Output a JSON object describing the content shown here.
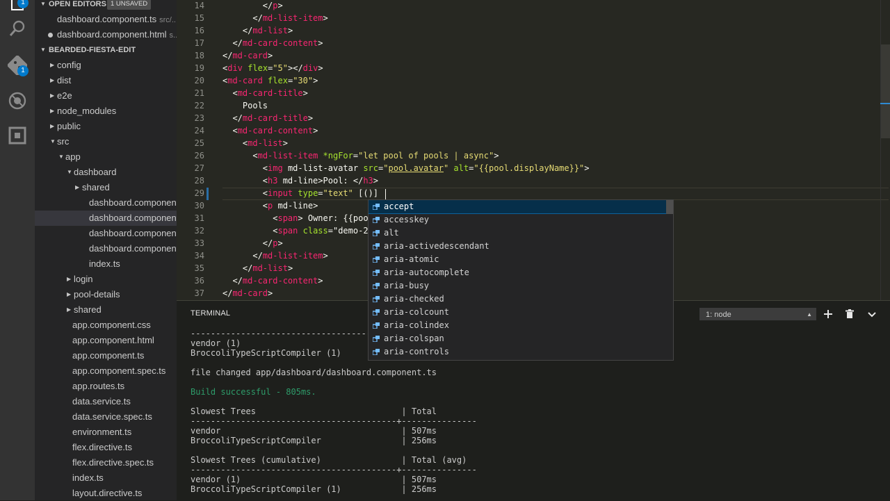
{
  "activity_bar": {
    "icons": [
      "explorer-icon",
      "search-icon",
      "source-control-icon",
      "debug-icon",
      "extensions-icon"
    ],
    "explorer_badge": "1",
    "scm_badge": "1"
  },
  "sidebar": {
    "open_editors": {
      "title": "OPEN EDITORS",
      "badge": "1 UNSAVED",
      "items": [
        {
          "name": "dashboard.component.ts",
          "desc": "src/...",
          "dirty": false
        },
        {
          "name": "dashboard.component.html",
          "desc": "s...",
          "dirty": true
        }
      ]
    },
    "project": {
      "title": "BEARDED-FIESTA-EDIT",
      "tree": [
        {
          "label": "config",
          "twisty": "closed"
        },
        {
          "label": "dist",
          "twisty": "closed"
        },
        {
          "label": "e2e",
          "twisty": "closed"
        },
        {
          "label": "node_modules",
          "twisty": "closed"
        },
        {
          "label": "public",
          "twisty": "closed"
        },
        {
          "label": "src",
          "twisty": "open"
        },
        {
          "label": "app",
          "twisty": "open"
        },
        {
          "label": "dashboard",
          "twisty": "open"
        },
        {
          "label": "shared",
          "twisty": "closed"
        },
        {
          "label": "dashboard.component....",
          "twisty": ""
        },
        {
          "label": "dashboard.component....",
          "twisty": "",
          "selected": true
        },
        {
          "label": "dashboard.component....",
          "twisty": ""
        },
        {
          "label": "dashboard.component....",
          "twisty": ""
        },
        {
          "label": "index.ts",
          "twisty": ""
        },
        {
          "label": "login",
          "twisty": "closed"
        },
        {
          "label": "pool-details",
          "twisty": "closed"
        },
        {
          "label": "shared",
          "twisty": "closed"
        },
        {
          "label": "app.component.css",
          "twisty": ""
        },
        {
          "label": "app.component.html",
          "twisty": ""
        },
        {
          "label": "app.component.ts",
          "twisty": ""
        },
        {
          "label": "app.component.spec.ts",
          "twisty": ""
        },
        {
          "label": "app.routes.ts",
          "twisty": ""
        },
        {
          "label": "data.service.ts",
          "twisty": ""
        },
        {
          "label": "data.service.spec.ts",
          "twisty": ""
        },
        {
          "label": "environment.ts",
          "twisty": ""
        },
        {
          "label": "flex.directive.ts",
          "twisty": ""
        },
        {
          "label": "flex.directive.spec.ts",
          "twisty": ""
        },
        {
          "label": "index.ts",
          "twisty": ""
        },
        {
          "label": "layout.directive.ts",
          "twisty": ""
        }
      ]
    }
  },
  "editor": {
    "lines": [
      {
        "num": "14",
        "text": "        </p>"
      },
      {
        "num": "15",
        "text": "      </md-list-item>"
      },
      {
        "num": "16",
        "text": "    </md-list>"
      },
      {
        "num": "17",
        "text": "  </md-card-content>"
      },
      {
        "num": "18",
        "text": "</md-card>"
      },
      {
        "num": "19",
        "text": "<div flex=\"5\"></div>"
      },
      {
        "num": "20",
        "text": "<md-card flex=\"30\">"
      },
      {
        "num": "21",
        "text": "  <md-card-title>"
      },
      {
        "num": "22",
        "text": "    Pools"
      },
      {
        "num": "23",
        "text": "  </md-card-title>"
      },
      {
        "num": "24",
        "text": "  <md-card-content>"
      },
      {
        "num": "25",
        "text": "    <md-list>"
      },
      {
        "num": "26",
        "text": "      <md-list-item *ngFor=\"let pool of pools | async\">"
      },
      {
        "num": "27",
        "text": "        <img md-list-avatar src=\"pool.avatar\" alt=\"{{pool.displayName}}\">"
      },
      {
        "num": "28",
        "text": "        <h3 md-line>Pool: </h3>"
      },
      {
        "num": "29",
        "text": "        <input type=\"text\" [()]"
      },
      {
        "num": "30",
        "text": "        <p md-line>"
      },
      {
        "num": "31",
        "text": "          <span> Owner: {{poo"
      },
      {
        "num": "32",
        "text": "          <span class=\"demo-2"
      },
      {
        "num": "33",
        "text": "        </p>"
      },
      {
        "num": "34",
        "text": "      </md-list-item>"
      },
      {
        "num": "35",
        "text": "    </md-list>"
      },
      {
        "num": "36",
        "text": "  </md-card-content>"
      },
      {
        "num": "37",
        "text": "</md-card>"
      }
    ]
  },
  "suggest": {
    "items": [
      "accept",
      "accesskey",
      "alt",
      "aria-activedescendant",
      "aria-atomic",
      "aria-autocomplete",
      "aria-busy",
      "aria-checked",
      "aria-colcount",
      "aria-colindex",
      "aria-colspan",
      "aria-controls"
    ],
    "focused_index": 0
  },
  "panel": {
    "title": "TERMINAL",
    "terminal_select": "1: node",
    "actions": {
      "add": "+",
      "trash": "trash-icon",
      "collapse": "chevron-down-icon"
    },
    "lines": [
      {
        "text": "-----------------------------------------------",
        "style": "normal"
      },
      {
        "text": "vendor (1)",
        "style": "normal"
      },
      {
        "text": "BroccoliTypeScriptCompiler (1)",
        "style": "normal"
      },
      {
        "text": "",
        "style": "normal"
      },
      {
        "text": "file changed app/dashboard/dashboard.component.ts",
        "style": "normal"
      },
      {
        "text": "",
        "style": "normal"
      },
      {
        "text": "Build successful - 805ms.",
        "style": "green"
      },
      {
        "text": "",
        "style": "normal"
      },
      {
        "text": "Slowest Trees                             | Total",
        "style": "normal"
      },
      {
        "text": "-----------------------------------------+---------------",
        "style": "normal"
      },
      {
        "text": "vendor                                    | 507ms",
        "style": "normal"
      },
      {
        "text": "BroccoliTypeScriptCompiler                | 256ms",
        "style": "normal"
      },
      {
        "text": "",
        "style": "normal"
      },
      {
        "text": "Slowest Trees (cumulative)                | Total (avg)",
        "style": "normal"
      },
      {
        "text": "-----------------------------------------+---------------",
        "style": "normal"
      },
      {
        "text": "vendor (1)                                | 507ms",
        "style": "normal"
      },
      {
        "text": "BroccoliTypeScriptCompiler (1)            | 256ms",
        "style": "normal"
      }
    ]
  }
}
